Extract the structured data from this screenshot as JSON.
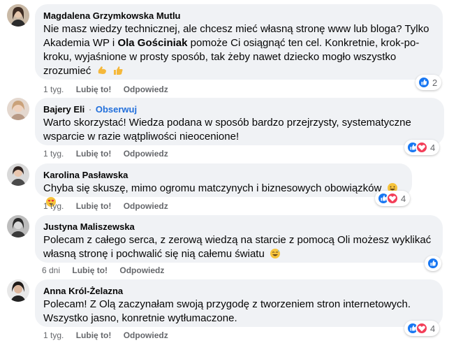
{
  "comments": [
    {
      "author": "Magdalena Grzymkowska Mutlu",
      "follow": "",
      "text_parts": [
        "Nie masz wiedzy technicznej, ale chcesz mieć własną stronę www lub bloga? Tylko Akademia WP i ",
        "Ola Gościniak",
        " pomoże Ci osiągnąć ten cel. Konkretnie, krok-po-kroku, wyjaśnione w prosty sposób, tak żeby nawet dziecko mogło wszystko zrozumieć"
      ],
      "emojis": [
        "flexed-biceps-emoji",
        "thumbs-up-emoji"
      ],
      "time": "1 tyg.",
      "like": "Lubię to!",
      "reply": "Odpowiedz",
      "reactions": [
        "like"
      ],
      "reaction_count": "2"
    },
    {
      "author": "Bajery Eli",
      "follow": "Obserwuj",
      "text_parts": [
        "Warto skorzystać! Wiedza podana w sposób bardzo przejrzysty, systematyczne wsparcie w razie wątpliwości nieocenione!"
      ],
      "emojis": [],
      "time": "1 tyg.",
      "like": "Lubię to!",
      "reply": "Odpowiedz",
      "reactions": [
        "like",
        "love"
      ],
      "reaction_count": "4"
    },
    {
      "author": "Karolina Pasławska",
      "follow": "",
      "text_parts": [
        "Chyba się skuszę, mimo ogromu matczynych i biznesowych obowiązków"
      ],
      "emojis": [
        "grinning-emoji",
        "heart-eyes-emoji"
      ],
      "time": "1 tyg.",
      "like": "Lubię to!",
      "reply": "Odpowiedz",
      "reactions": [
        "like",
        "love"
      ],
      "reaction_count": "4"
    },
    {
      "author": "Justyna Maliszewska",
      "follow": "",
      "text_parts": [
        "Polecam z całego serca, z zerową wiedzą na starcie z pomocą Oli możesz wyklikać własną stronę i pochwalić się nią całemu światu"
      ],
      "emojis": [
        "grinning-sweat-emoji"
      ],
      "time": "6 dni",
      "like": "Lubię to!",
      "reply": "Odpowiedz",
      "reactions": [
        "like"
      ],
      "reaction_count": ""
    },
    {
      "author": "Anna Król-Żelazna",
      "follow": "",
      "text_parts": [
        "Polecam! Z Olą zaczynałam swoją przygodę z tworzeniem stron internetowych. Wszystko jasno, konretnie wytłumaczone."
      ],
      "emojis": [],
      "time": "1 tyg.",
      "like": "Lubię to!",
      "reply": "Odpowiedz",
      "reactions": [
        "like",
        "love"
      ],
      "reaction_count": "4"
    }
  ],
  "colors": {
    "bubble": "#f0f2f5",
    "meta": "#65676b",
    "follow": "#216fdb",
    "like": "#1877f2",
    "love": "#f33e58"
  }
}
